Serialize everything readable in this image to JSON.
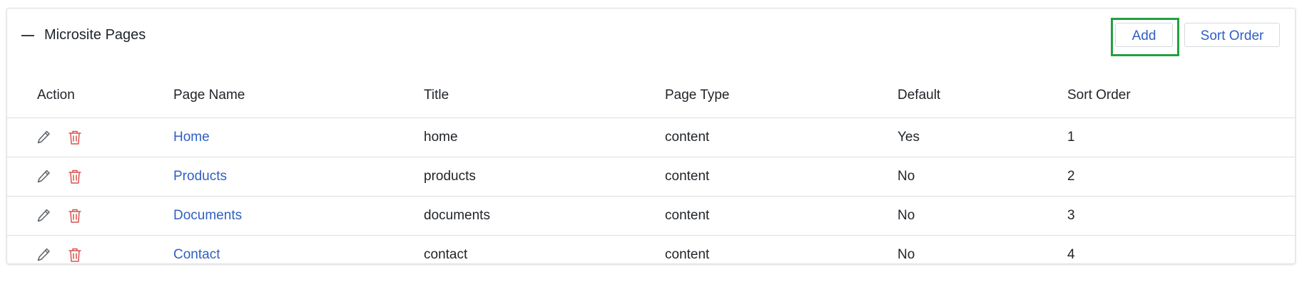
{
  "panel": {
    "title": "Microsite Pages",
    "add_label": "Add",
    "sort_order_label": "Sort Order"
  },
  "table": {
    "columns": [
      "Action",
      "Page Name",
      "Title",
      "Page Type",
      "Default",
      "Sort Order"
    ],
    "rows": [
      {
        "page_name": "Home",
        "title": "home",
        "page_type": "content",
        "default": "Yes",
        "sort_order": "1"
      },
      {
        "page_name": "Products",
        "title": "products",
        "page_type": "content",
        "default": "No",
        "sort_order": "2"
      },
      {
        "page_name": "Documents",
        "title": "documents",
        "page_type": "content",
        "default": "No",
        "sort_order": "3"
      },
      {
        "page_name": "Contact",
        "title": "contact",
        "page_type": "content",
        "default": "No",
        "sort_order": "4"
      }
    ]
  },
  "icons": {
    "collapse": "minus-icon",
    "edit": "pencil-icon",
    "delete": "trash-icon"
  },
  "colors": {
    "link": "#2f5fc4",
    "delete_icon": "#d9534f",
    "edit_icon": "#5b6168",
    "highlight": "#22a03f",
    "border": "#dcdfe3"
  }
}
